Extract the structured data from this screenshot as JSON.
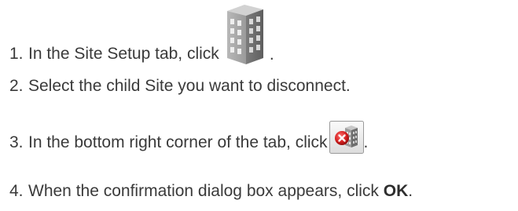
{
  "steps": [
    {
      "number": "1.",
      "text": "In the Site Setup tab, click",
      "icon": "building-icon",
      "suffix": "."
    },
    {
      "number": "2.",
      "text": "Select the child Site you want to disconnect."
    },
    {
      "number": "3.",
      "text": "In the bottom right corner of the tab, click",
      "icon": "remove-site-icon",
      "suffix": "."
    },
    {
      "number": "4.",
      "text": "When the confirmation dialog box appears, click ",
      "bold": "OK",
      "suffix": "."
    }
  ],
  "colors": {
    "text": "#3a3a3a",
    "icon_gray": "#8a8a8a",
    "remove_red": "#d42020"
  }
}
